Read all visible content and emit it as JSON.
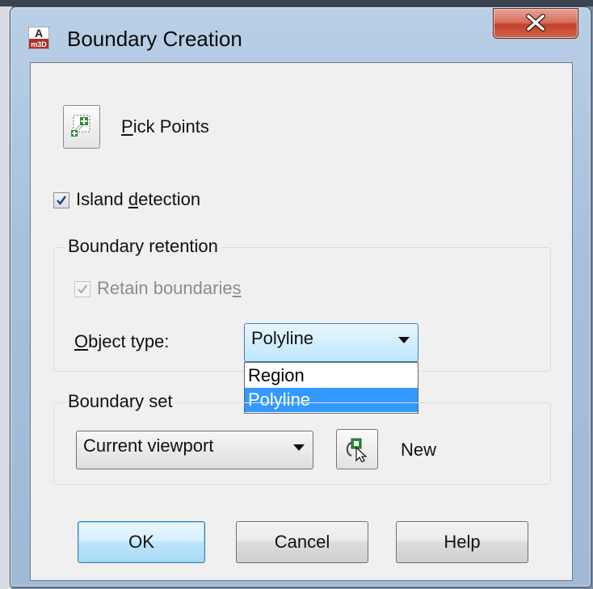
{
  "window": {
    "title": "Boundary Creation",
    "app_icon": "autocad-map-icon",
    "close_icon": "close-icon"
  },
  "pick_points": {
    "label_prefix": "",
    "label_mnemonic": "P",
    "label_rest": "ick Points",
    "icon": "pick-points-icon"
  },
  "island_detection": {
    "label_prefix": "Island ",
    "label_mnemonic": "d",
    "label_rest": "etection",
    "checked": true
  },
  "boundary_retention": {
    "title": "Boundary retention",
    "retain": {
      "label_prefix": "Retain boundarie",
      "label_mnemonic": "s",
      "label_rest": "",
      "checked": true,
      "enabled": false
    },
    "object_type": {
      "label_mnemonic": "O",
      "label_rest": "bject type:",
      "selected": "Polyline",
      "options": [
        "Region",
        "Polyline"
      ]
    }
  },
  "boundary_set": {
    "title": "Boundary set",
    "selected": "Current viewport",
    "new_label": "New",
    "new_icon": "select-new-set-icon"
  },
  "buttons": {
    "ok": "OK",
    "cancel": "Cancel",
    "help": "Help"
  },
  "colors": {
    "selection": "#3399ff",
    "title_bar": "#b9cfe6",
    "close_button": "#c2402a"
  }
}
